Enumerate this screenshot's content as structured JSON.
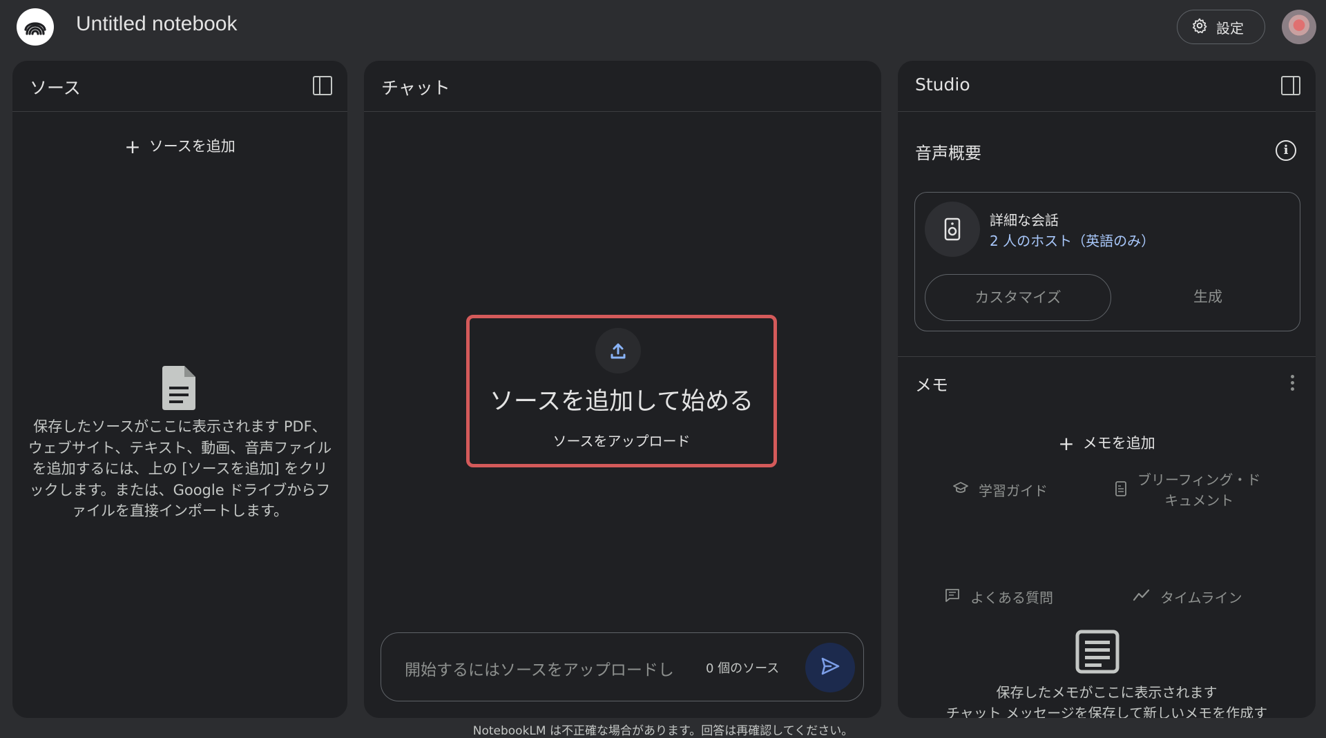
{
  "header": {
    "title": "Untitled notebook",
    "settings_label": "設定"
  },
  "sources": {
    "title": "ソース",
    "add_label": "ソースを追加",
    "empty_text": "保存したソースがここに表示されます PDF、ウェブサイト、テキスト、動画、音声ファイルを追加するには、上の [ソースを追加] をクリックします。または、Google ドライブからファイルを直接インポートします。"
  },
  "chat": {
    "title": "チャット",
    "upload_title": "ソースを追加して始める",
    "upload_label": "ソースをアップロード",
    "input_placeholder": "開始するにはソースをアップロードし",
    "source_count": "0 個のソース"
  },
  "studio": {
    "title": "Studio",
    "audio_overview": {
      "title": "音声概要",
      "card_title": "詳細な会話",
      "card_subtitle": "2 人のホスト（英語のみ）",
      "customize_label": "カスタマイズ",
      "generate_label": "生成"
    },
    "memo": {
      "title": "メモ",
      "add_label": "メモを追加",
      "options": {
        "study_guide": "学習ガイド",
        "briefing_line1": "ブリーフィング・ド",
        "briefing_line2": "キュメント",
        "faq": "よくある質問",
        "timeline": "タイムライン"
      },
      "empty_line1": "保存したメモがここに表示されます",
      "empty_line2": "チャット メッセージを保存して新しいメモを作成す"
    }
  },
  "footer": {
    "disclaimer": "NotebookLM は不正確な場合があります。回答は再確認してください。"
  },
  "colors": {
    "background": "#2c2d30",
    "panel": "#1f2023",
    "highlight_border": "#d45a5a",
    "accent_blue": "#a8c7fa"
  }
}
